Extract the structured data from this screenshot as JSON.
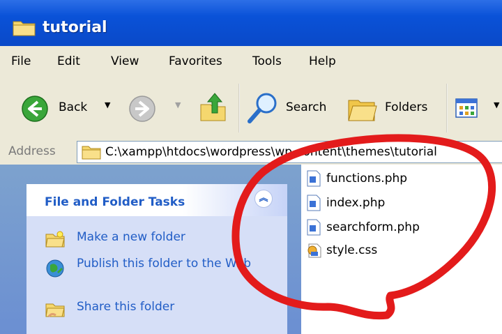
{
  "window": {
    "title": "tutorial"
  },
  "menubar": {
    "items": [
      "File",
      "Edit",
      "View",
      "Favorites",
      "Tools",
      "Help"
    ]
  },
  "toolbar": {
    "back_label": "Back",
    "search_label": "Search",
    "folders_label": "Folders"
  },
  "address": {
    "label": "Address",
    "path": "C:\\xampp\\htdocs\\wordpress\\wp-content\\themes\\tutorial"
  },
  "tasks": {
    "header": "File and Folder Tasks",
    "items": [
      {
        "label": "Make a new folder",
        "icon": "new-folder-icon"
      },
      {
        "label": "Publish this folder to the Web",
        "icon": "publish-web-icon"
      },
      {
        "label": "Share this folder",
        "icon": "share-folder-icon"
      }
    ]
  },
  "files": [
    {
      "name": "functions.php",
      "icon": "php-file-icon"
    },
    {
      "name": "index.php",
      "icon": "php-file-icon"
    },
    {
      "name": "searchform.php",
      "icon": "php-file-icon"
    },
    {
      "name": "style.css",
      "icon": "css-file-icon"
    }
  ],
  "colors": {
    "titlebar": "#0a52d8",
    "annotation": "#e31b1b",
    "task_link": "#215dc6",
    "pane_bg": "#6b8fd2"
  }
}
